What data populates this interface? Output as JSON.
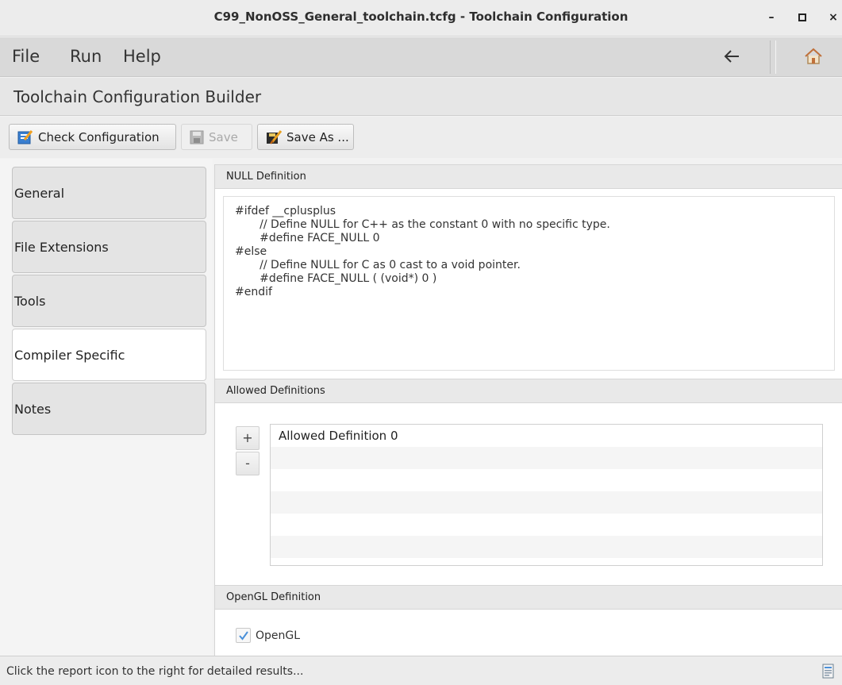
{
  "window": {
    "title": "C99_NonOSS_General_toolchain.tcfg - Toolchain Configuration",
    "minimize": "–",
    "maximize": "▫",
    "close": "×"
  },
  "menubar": {
    "items": [
      "File",
      "Run",
      "Help"
    ],
    "back_icon": "arrow-left-icon",
    "home_icon": "home-icon"
  },
  "header": {
    "title": "Toolchain Configuration Builder"
  },
  "toolbar": {
    "check_label": "Check Configuration",
    "save_label": "Save",
    "save_as_label": "Save As ..."
  },
  "sidebar": {
    "tabs": [
      {
        "label": "General",
        "active": false
      },
      {
        "label": "File Extensions",
        "active": false
      },
      {
        "label": "Tools",
        "active": false
      },
      {
        "label": "Compiler Specific",
        "active": true
      },
      {
        "label": "Notes",
        "active": false
      }
    ]
  },
  "null_definition": {
    "heading": "NULL Definition",
    "code": "#ifdef __cplusplus\n       // Define NULL for C++ as the constant 0 with no specific type.\n       #define FACE_NULL 0\n#else\n       // Define NULL for C as 0 cast to a void pointer.\n       #define FACE_NULL ( (void*) 0 )\n#endif"
  },
  "allowed_definitions": {
    "heading": "Allowed Definitions",
    "add_label": "+",
    "remove_label": "-",
    "items": [
      "Allowed Definition 0",
      "",
      "",
      "",
      "",
      ""
    ]
  },
  "opengl_definition": {
    "heading": "OpenGL Definition",
    "checkbox_label": "OpenGL",
    "checked": true
  },
  "status": {
    "text": "Click the report icon to the right for detailed results..."
  },
  "colors": {
    "menubar_bg": "#d9d9d9",
    "check_mark": "#4a90d9"
  }
}
